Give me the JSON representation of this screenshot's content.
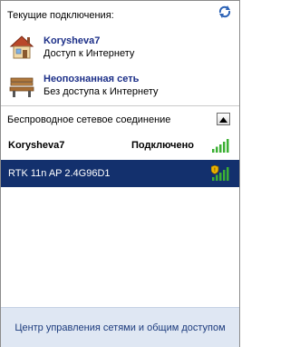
{
  "current": {
    "header": "Текущие подключения:",
    "refresh_icon": "refresh-arrows-icon",
    "networks": [
      {
        "name": "Korysheva7",
        "status": "Доступ к Интернету",
        "icon": "house-network-icon"
      },
      {
        "name": "Неопознанная сеть",
        "status": "Без доступа к Интернету",
        "icon": "park-bench-network-icon"
      }
    ]
  },
  "wireless": {
    "header": "Беспроводное сетевое соединение",
    "collapse_icon": "collapse-up-icon",
    "items": [
      {
        "ssid": "Korysheva7",
        "state": "Подключено",
        "signal_bars": 5,
        "secured": false
      },
      {
        "ssid": "RTK 11n AP 2.4G96D1",
        "state": "",
        "signal_bars": 5,
        "secured": true
      }
    ]
  },
  "footer": {
    "link": "Центр управления сетями и общим доступом"
  },
  "colors": {
    "selected_bg": "#13306d",
    "network_name": "#1c2f88",
    "signal_green": "#3cb034",
    "footer_bg": "#dfe7f3",
    "shield_yellow": "#f0b400"
  }
}
